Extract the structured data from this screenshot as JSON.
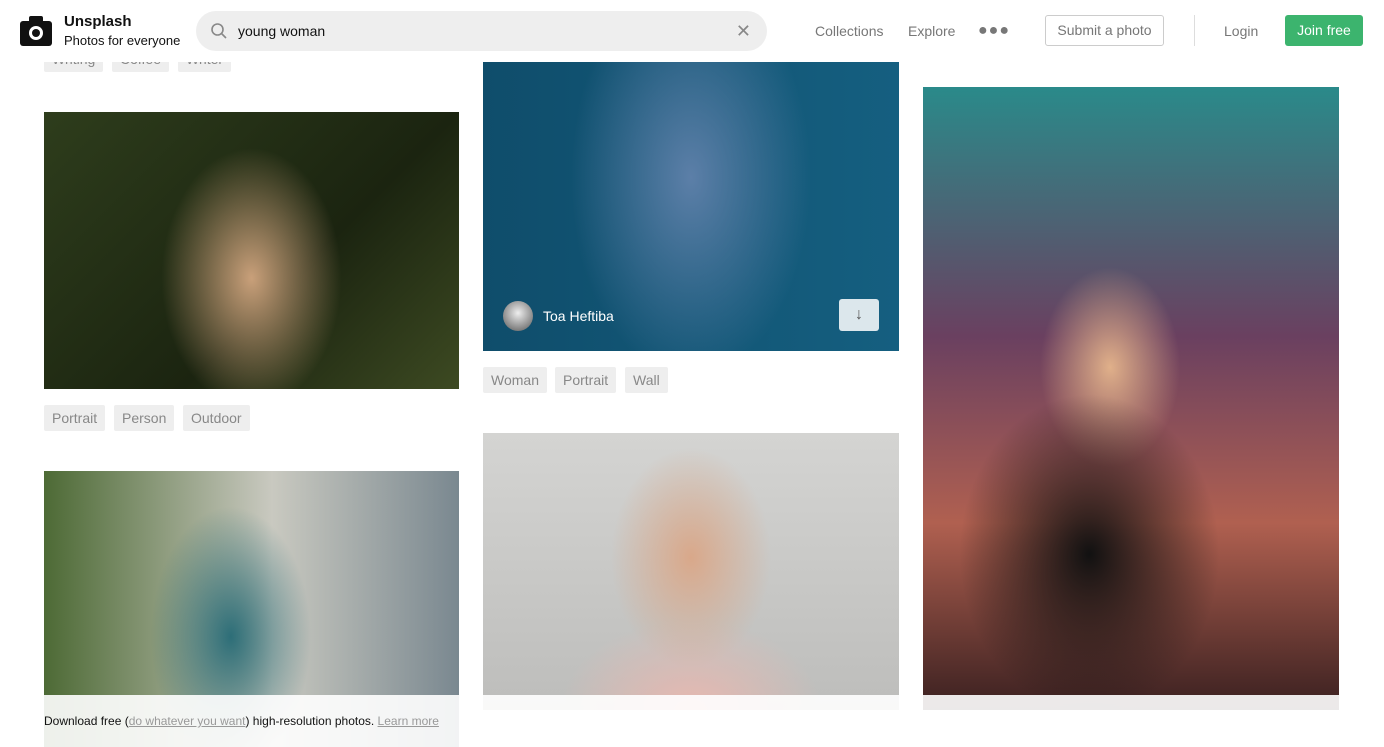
{
  "header": {
    "brand": "Unsplash",
    "tagline": "Photos for everyone",
    "search_value": "young woman",
    "nav": [
      "Collections",
      "Explore"
    ],
    "submit": "Submit a photo",
    "login": "Login",
    "join": "Join free",
    "accent": "#3cb46e"
  },
  "tags": {
    "top": [
      "Writing",
      "Coffee",
      "Writer"
    ],
    "photo1": [
      "Portrait",
      "Person",
      "Outdoor"
    ],
    "photo_denim": [
      "Woman",
      "Portrait",
      "Wall"
    ]
  },
  "denim_photo": {
    "author": "Toa Heftiba"
  },
  "banner": {
    "pre": "Download free (",
    "link": "do whatever you want",
    "mid": ") high-resolution photos. ",
    "learn": "Learn more"
  }
}
